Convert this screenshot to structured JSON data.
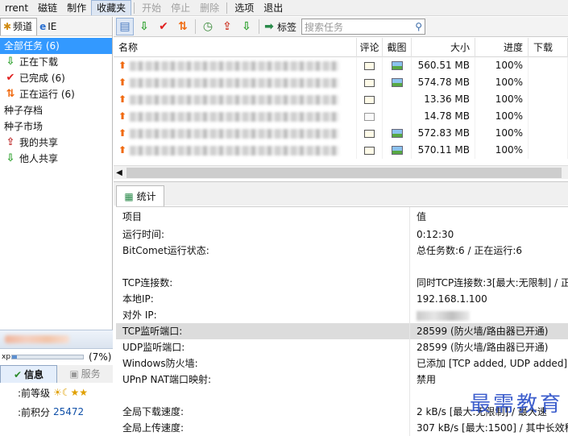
{
  "menu": {
    "items": [
      {
        "label": "rrent",
        "state": "normal"
      },
      {
        "label": "磁链",
        "state": "normal"
      },
      {
        "label": "制作",
        "state": "normal"
      },
      {
        "label": "收藏夹",
        "state": "active"
      },
      {
        "label": "开始",
        "state": "disabled"
      },
      {
        "label": "停止",
        "state": "disabled"
      },
      {
        "label": "删除",
        "state": "disabled"
      },
      {
        "label": "选项",
        "state": "normal"
      },
      {
        "label": "退出",
        "state": "normal"
      }
    ]
  },
  "left_panel": {
    "tabs": [
      {
        "label": "频道"
      },
      {
        "label": "IE"
      }
    ],
    "tree": [
      {
        "label": "全部任务 (6)",
        "icon": "download-arrow-icon",
        "selected": true
      },
      {
        "label": "正在下载",
        "icon": "down-arrow-icon"
      },
      {
        "label": "已完成 (6)",
        "icon": "checkmark-icon"
      },
      {
        "label": "正在运行 (6)",
        "icon": "updown-arrow-icon"
      },
      {
        "label": "种子存档",
        "icon": ""
      },
      {
        "label": "种子市场",
        "icon": ""
      },
      {
        "label": "我的共享",
        "icon": "share-icon"
      },
      {
        "label": "他人共享",
        "icon": "share-icon"
      }
    ],
    "user": {
      "progress_text": "(7%)",
      "progress_value": 0.07,
      "exp_label": "xp",
      "tabs": [
        {
          "label": "信息"
        },
        {
          "label": "服务"
        }
      ],
      "rows": [
        {
          "key": "前等级:",
          "value": "☀☾★★"
        },
        {
          "key": "前积分:",
          "value": "25472"
        }
      ]
    }
  },
  "toolbar": {
    "tag_label": "标签",
    "search_placeholder": "搜索任务"
  },
  "task_list": {
    "columns": [
      "名称",
      "评论",
      "截图",
      "大小",
      "进度",
      "下载"
    ],
    "rows": [
      {
        "comment": "envelope",
        "screenshot": true,
        "size": "560.51 MB",
        "progress": "100%"
      },
      {
        "comment": "envelope",
        "screenshot": true,
        "size": "574.78 MB",
        "progress": "100%"
      },
      {
        "comment": "envelope",
        "screenshot": false,
        "size": "13.36 MB",
        "progress": "100%"
      },
      {
        "comment": "envelope-gray",
        "screenshot": false,
        "size": "14.78 MB",
        "progress": "100%"
      },
      {
        "comment": "envelope",
        "screenshot": true,
        "size": "572.83 MB",
        "progress": "100%"
      },
      {
        "comment": "envelope",
        "screenshot": true,
        "size": "570.11 MB",
        "progress": "100%"
      }
    ]
  },
  "bottom_tab": {
    "label": "统计"
  },
  "stats": {
    "header": {
      "key": "项目",
      "value": "值"
    },
    "rows": [
      {
        "key": "运行时间:",
        "value": "0:12:30"
      },
      {
        "key": "BitComet运行状态:",
        "value": "总任务数:6 / 正在运行:6"
      },
      {
        "key": "",
        "value": ""
      },
      {
        "key": "TCP连接数:",
        "value": "同时TCP连接数:3[最大:无限制] / 正在"
      },
      {
        "key": "本地IP:",
        "value": "192.168.1.100"
      },
      {
        "key": "对外 IP:",
        "value": ""
      },
      {
        "key": "TCP监听端口:",
        "value": "28599 (防火墙/路由器已开通)",
        "highlight": true
      },
      {
        "key": "UDP监听端口:",
        "value": "28599 (防火墙/路由器已开通)"
      },
      {
        "key": "Windows防火墙:",
        "value": "已添加 [TCP added, UDP added]"
      },
      {
        "key": "UPnP NAT端口映射:",
        "value": "禁用"
      },
      {
        "key": "",
        "value": ""
      },
      {
        "key": "全局下载速度:",
        "value": "2 kB/s [最大:无限制] / 最大速"
      },
      {
        "key": "全局上传速度:",
        "value": "307 kB/s [最大:1500] / 其中长效种"
      }
    ]
  },
  "watermark": "最需教育",
  "colors": {
    "selected": "#3399ff",
    "accent": "#f06a10",
    "link": "#1050a8"
  }
}
